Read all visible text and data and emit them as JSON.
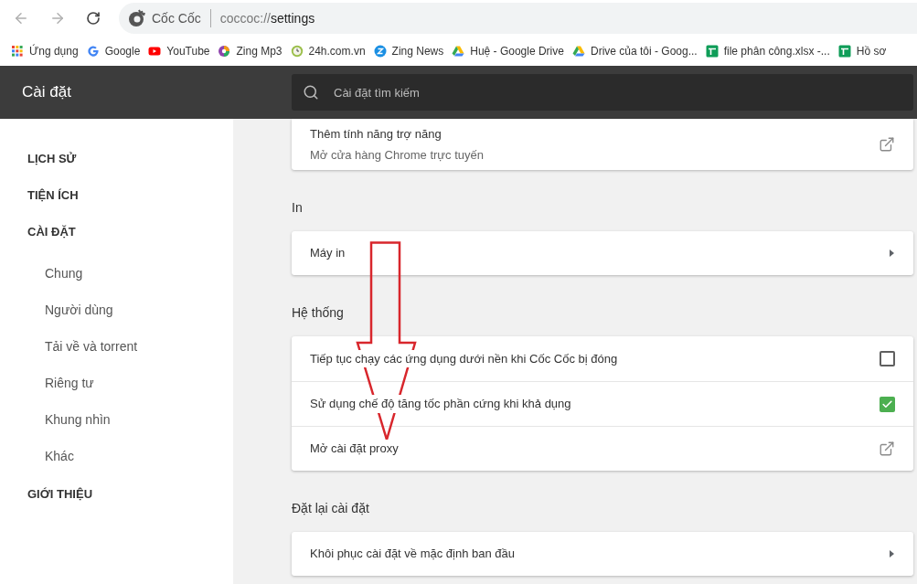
{
  "toolbar": {
    "brand": "Cốc Cốc",
    "url_scheme": "coccoc://",
    "url_path": "settings"
  },
  "bookmarks": [
    {
      "kind": "apps",
      "label": "Ứng dụng"
    },
    {
      "kind": "google",
      "label": "Google"
    },
    {
      "kind": "youtube",
      "label": "YouTube"
    },
    {
      "kind": "disc",
      "label": "Zing Mp3"
    },
    {
      "kind": "clock",
      "label": "24h.com.vn"
    },
    {
      "kind": "zing",
      "label": "Zing News"
    },
    {
      "kind": "drive",
      "label": "Huệ - Google Drive"
    },
    {
      "kind": "drive",
      "label": "Drive của tôi - Goog..."
    },
    {
      "kind": "sheets",
      "label": "file phân công.xlsx -..."
    },
    {
      "kind": "sheets",
      "label": "Hồ sơ"
    }
  ],
  "header": {
    "title": "Cài đặt",
    "search_placeholder": "Cài đặt tìm kiếm"
  },
  "sidebar": {
    "items": [
      {
        "label": "LỊCH SỬ"
      },
      {
        "label": "TIỆN ÍCH"
      },
      {
        "label": "CÀI ĐẶT",
        "children": [
          {
            "label": "Chung"
          },
          {
            "label": "Người dùng"
          },
          {
            "label": "Tải về và torrent"
          },
          {
            "label": "Riêng tư"
          },
          {
            "label": "Khung nhìn"
          },
          {
            "label": "Khác"
          }
        ]
      },
      {
        "label": "GIỚI THIỆU"
      }
    ]
  },
  "sections": [
    {
      "rows": [
        {
          "kind": "link",
          "label": "Thêm tính năng trợ năng",
          "sublabel": "Mở cửa hàng Chrome trực tuyến"
        }
      ]
    },
    {
      "heading": "In",
      "rows": [
        {
          "kind": "submenu",
          "label": "Máy in"
        }
      ]
    },
    {
      "heading": "Hệ thống",
      "rows": [
        {
          "kind": "checkbox",
          "label": "Tiếp tục chạy các ứng dụng dưới nền khi Cốc Cốc bị đóng",
          "checked": false
        },
        {
          "kind": "checkbox",
          "label": "Sử dụng chế độ tăng tốc phần cứng khi khả dụng",
          "checked": true
        },
        {
          "kind": "link",
          "label": "Mở cài đặt proxy"
        }
      ]
    },
    {
      "heading": "Đặt lại cài đặt",
      "rows": [
        {
          "kind": "submenu",
          "label": "Khôi phục cài đặt về mặc định ban đầu"
        }
      ]
    }
  ]
}
